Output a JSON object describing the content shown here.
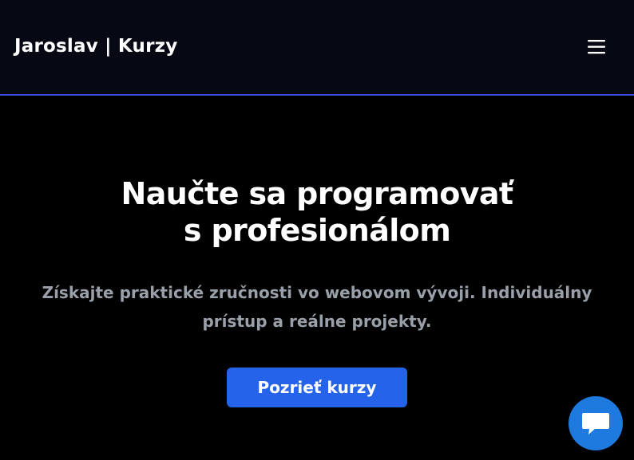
{
  "header": {
    "brand": "Jaroslav | Kurzy",
    "menu_icon": "hamburger-menu-icon"
  },
  "hero": {
    "title_line1": "Naučte sa programovať",
    "title_line2": "s profesionálom",
    "subtitle_line1": "Získajte praktické zručnosti vo webovom vývoji. Individuálny",
    "subtitle_line2": "prístup a reálne projekty.",
    "cta_label": "Pozrieť kurzy"
  },
  "chat": {
    "icon": "chat-bubble-icon"
  },
  "colors": {
    "page_background": "#000000",
    "header_background": "#060913",
    "header_border": "#3b4fd9",
    "cta_background": "#2563eb",
    "chat_background": "#1f7ae0",
    "subtitle_text": "#9aa0aa"
  }
}
